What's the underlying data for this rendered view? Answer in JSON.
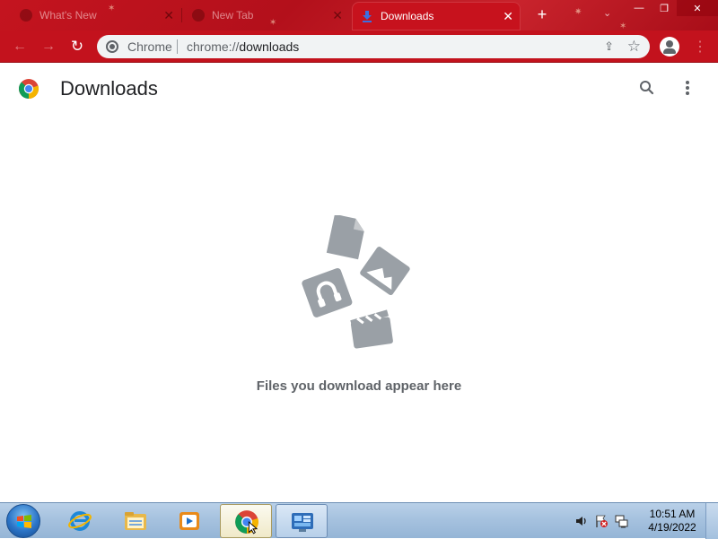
{
  "window": {
    "tabs": [
      {
        "label": "What's New",
        "active": false
      },
      {
        "label": "New Tab",
        "active": false
      },
      {
        "label": "Downloads",
        "active": true
      }
    ],
    "controls": {
      "minimize": "—",
      "restore": "❐",
      "close": "✕"
    }
  },
  "toolbar": {
    "omnibox_chip": "Chrome",
    "url_prefix": "chrome://",
    "url_path": "downloads"
  },
  "page": {
    "title": "Downloads",
    "empty_message": "Files you download appear here"
  },
  "taskbar": {
    "pinned": [
      "start-orb",
      "internet-explorer-icon",
      "file-explorer-icon",
      "media-player-icon",
      "chrome-icon",
      "control-panel-icon"
    ],
    "clock_time": "10:51 AM",
    "clock_date": "4/19/2022"
  },
  "colors": {
    "theme_red": "#c3121d",
    "omnibox_bg": "#f1f3f4",
    "icon_gray": "#5f6368",
    "illustration_gray": "#9aa0a6"
  }
}
